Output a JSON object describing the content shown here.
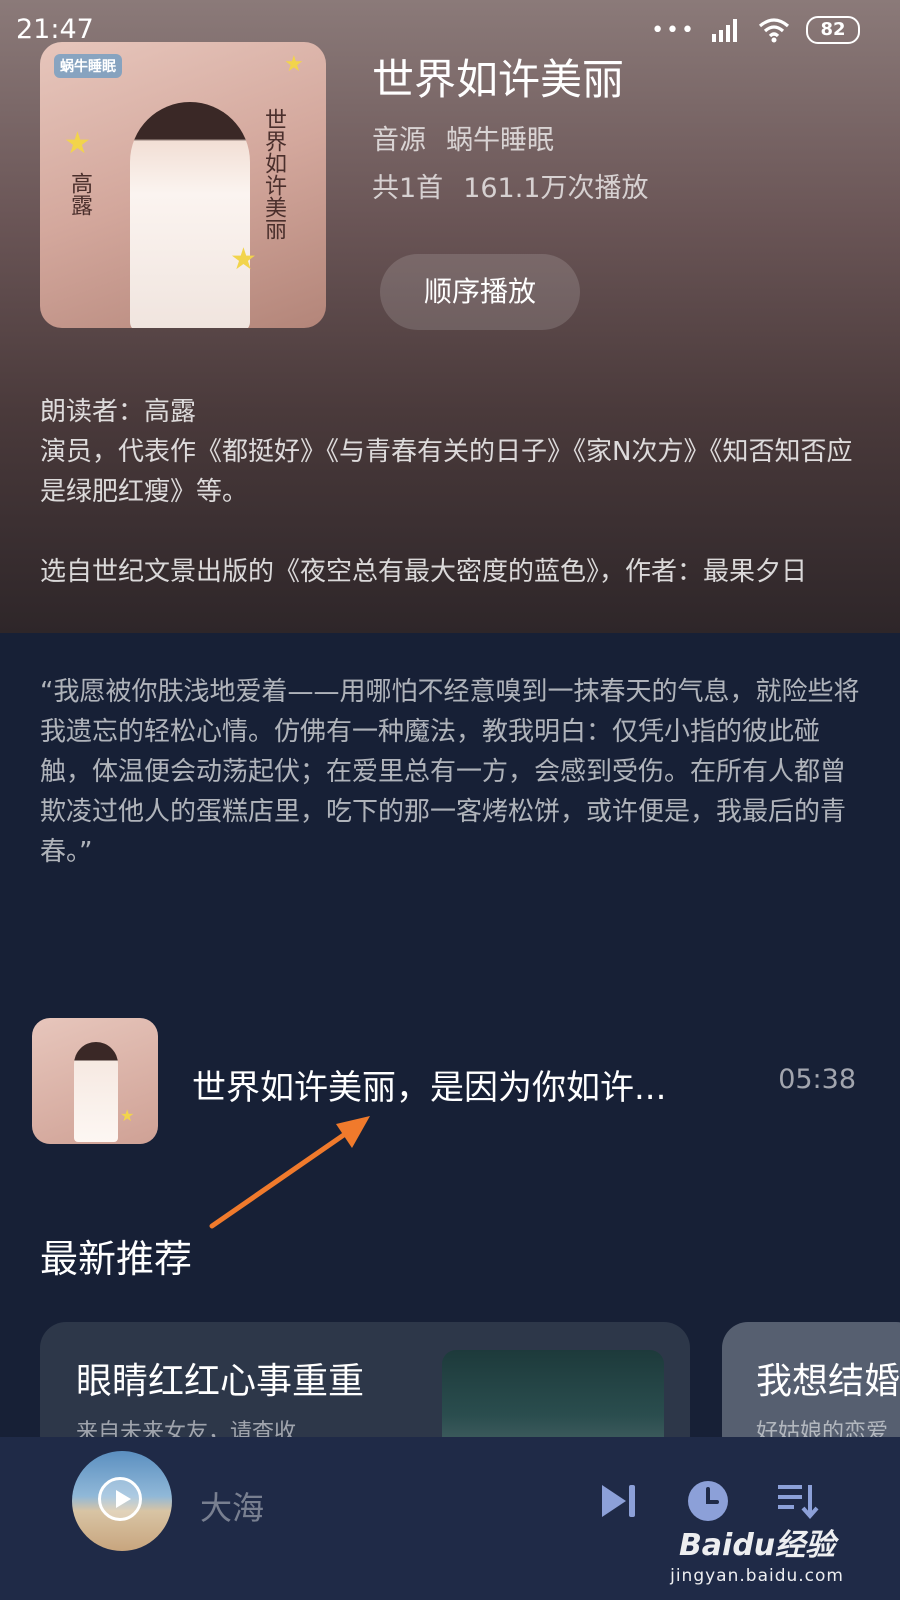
{
  "status_bar": {
    "time": "21:47",
    "battery": "82"
  },
  "album": {
    "title": "世界如许美丽",
    "source_label": "音源",
    "source_name": "蜗牛睡眠",
    "track_count": "共1首",
    "play_count": "161.1万次播放",
    "play_button": "顺序播放",
    "cover_text": {
      "logo": "蜗牛睡眠",
      "narrator": "高露",
      "book": "世界如许美丽"
    }
  },
  "description": {
    "narrator_line": "朗读者：高露",
    "narrator_bio": "演员，代表作《都挺好》《与青春有关的日子》《家N次方》《知否知否应是绿肥红瘦》等。",
    "source_line": "选自世纪文景出版的《夜空总有最大密度的蓝色》，作者：最果夕日"
  },
  "quote": "“我愿被你肤浅地爱着——用哪怕不经意嗅到一抹春天的气息，就险些将我遗忘的轻松心情。仿佛有一种魔法，教我明白：仅凭小指的彼此碰触，体温便会动荡起伏；在爱里总有一方，会感到受伤。在所有人都曾欺凌过他人的蛋糕店里，吃下的那一客烤松饼，或许便是，我最后的青春。”",
  "track": {
    "title": "世界如许美丽，是因为你如许...",
    "duration": "05:38"
  },
  "recommend": {
    "section_title": "最新推荐",
    "cards": [
      {
        "title": "眼睛红红心事重重",
        "subtitle": "来自未来女友，请查收"
      },
      {
        "title": "我想结婚",
        "subtitle": "好姑娘的恋爱"
      }
    ]
  },
  "player": {
    "song": "大海"
  },
  "watermark": {
    "brand": "Baidu经验",
    "url": "jingyan.baidu.com"
  },
  "colors": {
    "background": "#172036",
    "player_bar": "#1f2a47",
    "arrow": "#f07a2c",
    "star": "#f2d44b"
  },
  "icons": [
    "signal-icon",
    "wifi-icon",
    "battery-icon",
    "next-track-icon",
    "timer-icon",
    "playlist-icon",
    "play-icon"
  ]
}
